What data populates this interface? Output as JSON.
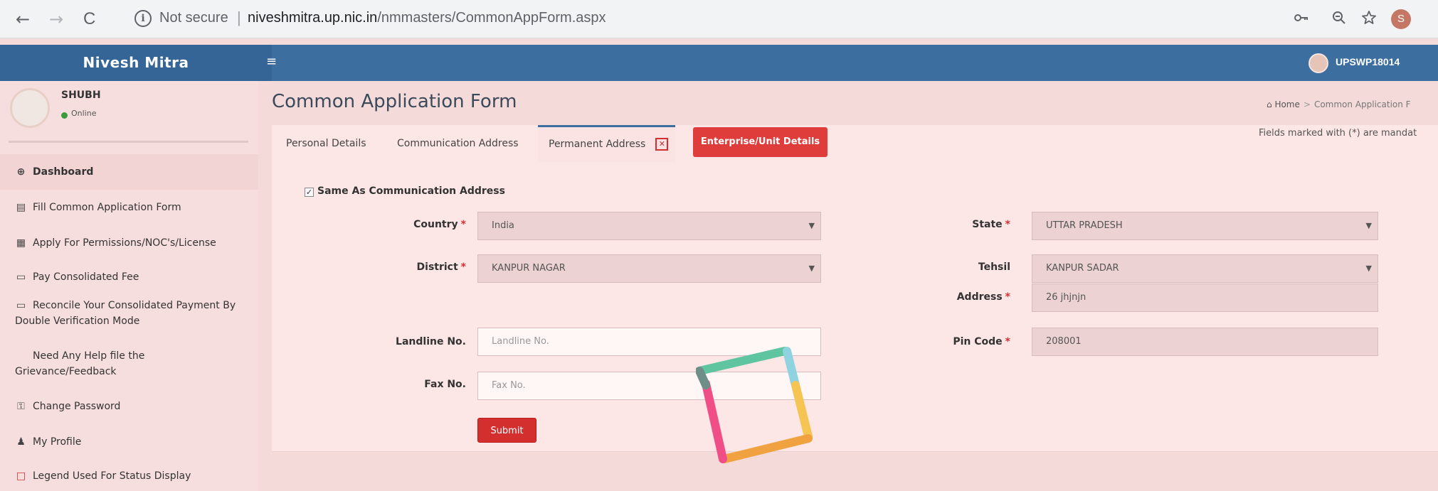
{
  "browser": {
    "back": "←",
    "forward": "→",
    "reload": "C",
    "info_glyph": "i",
    "not_secure": "Not secure",
    "separator": "|",
    "url_host": "niveshmitra.up.nic.in",
    "url_path": "/nmmasters/CommonAppForm.aspx",
    "key_icon": "key-icon",
    "zoom_icon": "zoom-icon",
    "star_icon": "star-icon",
    "profile_initial": "S"
  },
  "header": {
    "brand": "Nivesh Mitra",
    "menu_glyph": "≡",
    "user_id": "UPSWP18014"
  },
  "sidebar": {
    "profile": {
      "name": "SHUBH",
      "status": "Online"
    },
    "items": [
      {
        "label": "Dashboard",
        "icon": "dashboard-icon",
        "glyph": "⊕"
      },
      {
        "label": "Fill Common Application Form",
        "icon": "form-icon",
        "glyph": "▤"
      },
      {
        "label": "Apply For Permissions/NOC's/License",
        "icon": "document-icon",
        "glyph": "▦"
      },
      {
        "label": "Pay Consolidated Fee",
        "icon": "card-icon",
        "glyph": "▭"
      },
      {
        "label": "Reconcile Your Consolidated Payment By",
        "label2": "Double Verification Mode",
        "icon": "card-icon",
        "glyph": "▭"
      },
      {
        "label": "Need Any Help file the",
        "label2": "Grievance/Feedback",
        "icon": "",
        "glyph": ""
      },
      {
        "label": "Change Password",
        "icon": "key-icon",
        "glyph": "⚿"
      },
      {
        "label": "My Profile",
        "icon": "user-icon",
        "glyph": "♟"
      },
      {
        "label": "Legend Used For Status Display",
        "icon": "legend-icon",
        "glyph": "□"
      }
    ]
  },
  "main": {
    "title": "Common Application Form",
    "breadcrumb": {
      "home": "Home",
      "separator": ">",
      "current": "Common Application F"
    },
    "tabs": [
      {
        "label": "Personal Details"
      },
      {
        "label": "Communication Address"
      },
      {
        "label": "Permanent Address",
        "close_glyph": "✕"
      },
      {
        "label": "Enterprise/Unit Details"
      }
    ],
    "mandatory_note": "Fields marked with (*) are mandat",
    "same_as_label": "Same As Communication Address",
    "same_as_checked": "✓",
    "form": {
      "country_label": "Country",
      "country_value": "India",
      "state_label": "State",
      "state_value": "UTTAR PRADESH",
      "district_label": "District",
      "district_value": "KANPUR NAGAR",
      "tehsil_label": "Tehsil",
      "tehsil_value": "KANPUR SADAR",
      "address_label": "Address",
      "address_value": "26 jhjnjn",
      "landline_label": "Landline No.",
      "landline_placeholder": "Landline No.",
      "pincode_label": "Pin Code",
      "pincode_value": "208001",
      "fax_label": "Fax No.",
      "fax_placeholder": "Fax No.",
      "required_mark": "*",
      "dropdown_caret": "▼"
    },
    "submit_label": "Submit"
  },
  "colors": {
    "header_bg": "#3c6e9f",
    "sidebar_bg": "#f7dede",
    "panel_bg": "#fde6e6",
    "accent_red": "#df3c3c"
  }
}
